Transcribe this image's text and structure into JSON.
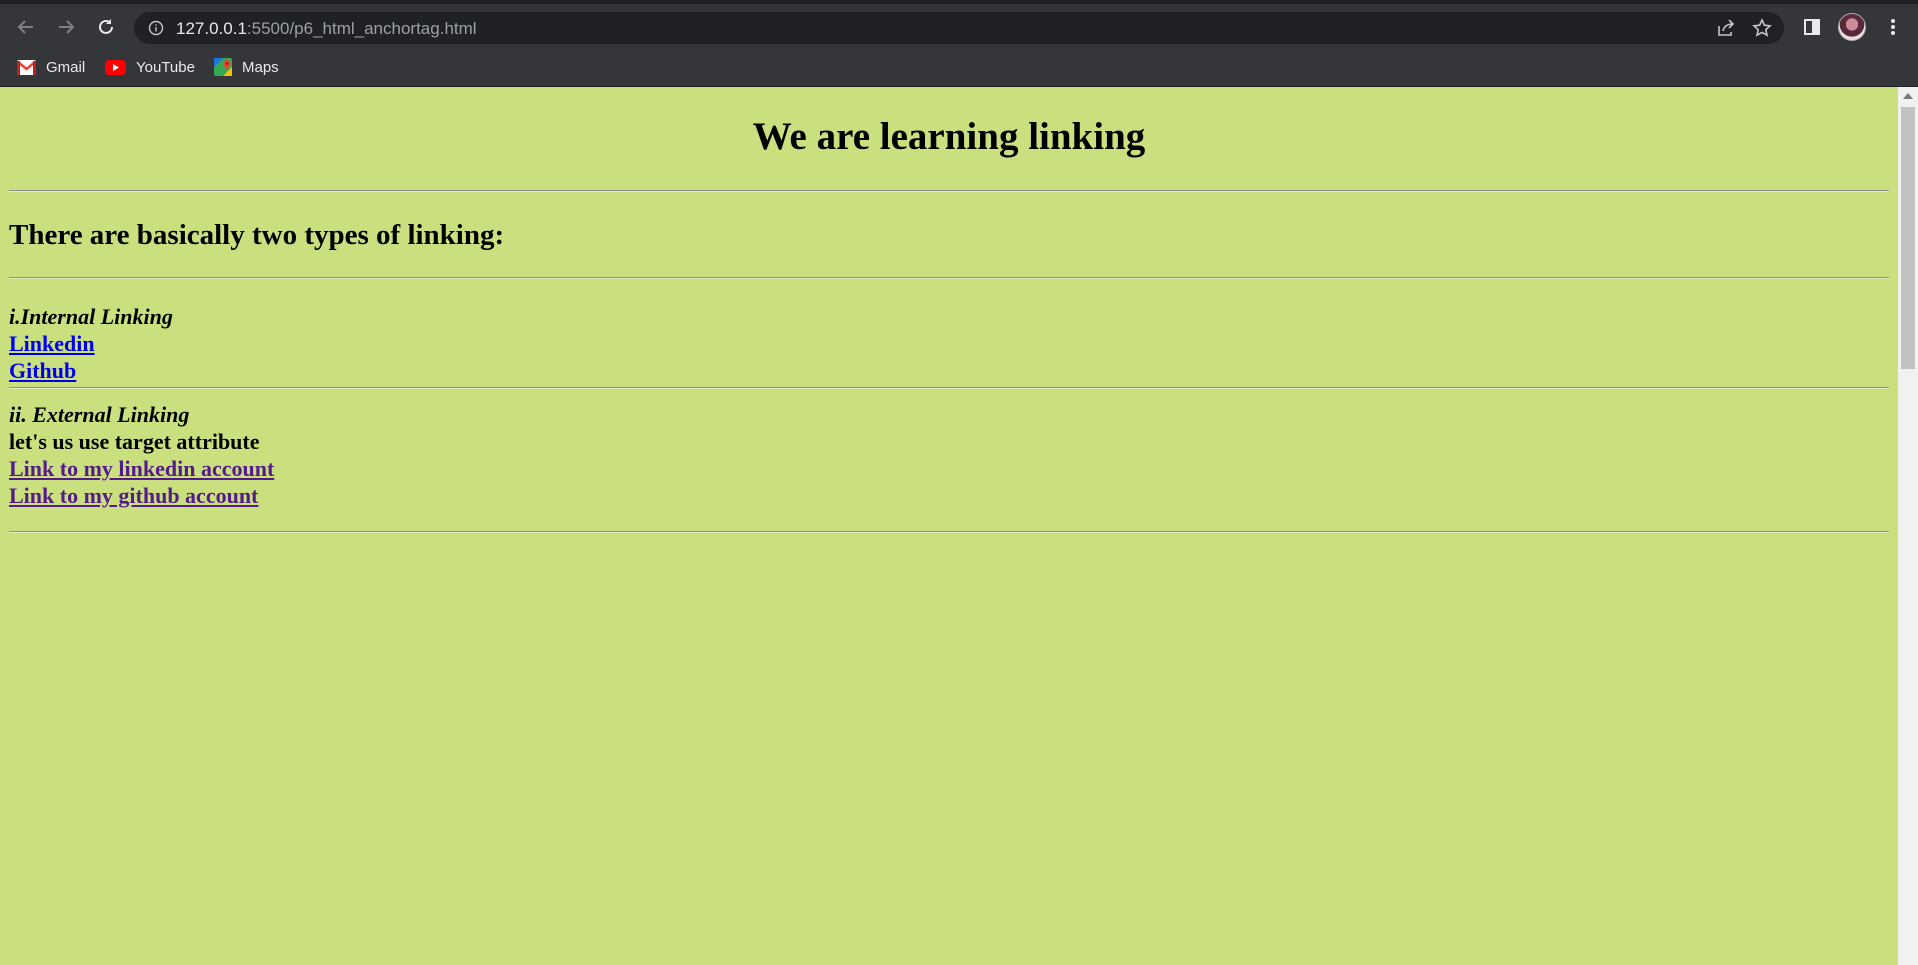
{
  "browser": {
    "url_host": "127.0.0.1",
    "url_rest": ":5500/p6_html_anchortag.html",
    "bookmarks": [
      {
        "label": "Gmail",
        "icon": "gmail-icon"
      },
      {
        "label": "YouTube",
        "icon": "youtube-icon"
      },
      {
        "label": "Maps",
        "icon": "maps-icon"
      }
    ]
  },
  "page": {
    "background": "#cae07f",
    "title": "We are learning linking",
    "subtitle": "There are basically two types of linking:",
    "internal": {
      "heading": "i.Internal Linking",
      "links": [
        "Linkedin",
        "Github"
      ]
    },
    "external": {
      "heading": "ii. External Linking",
      "note": "let's us use target attribute",
      "links": [
        "Link to my linkedin account",
        "Link to my github account"
      ]
    }
  }
}
